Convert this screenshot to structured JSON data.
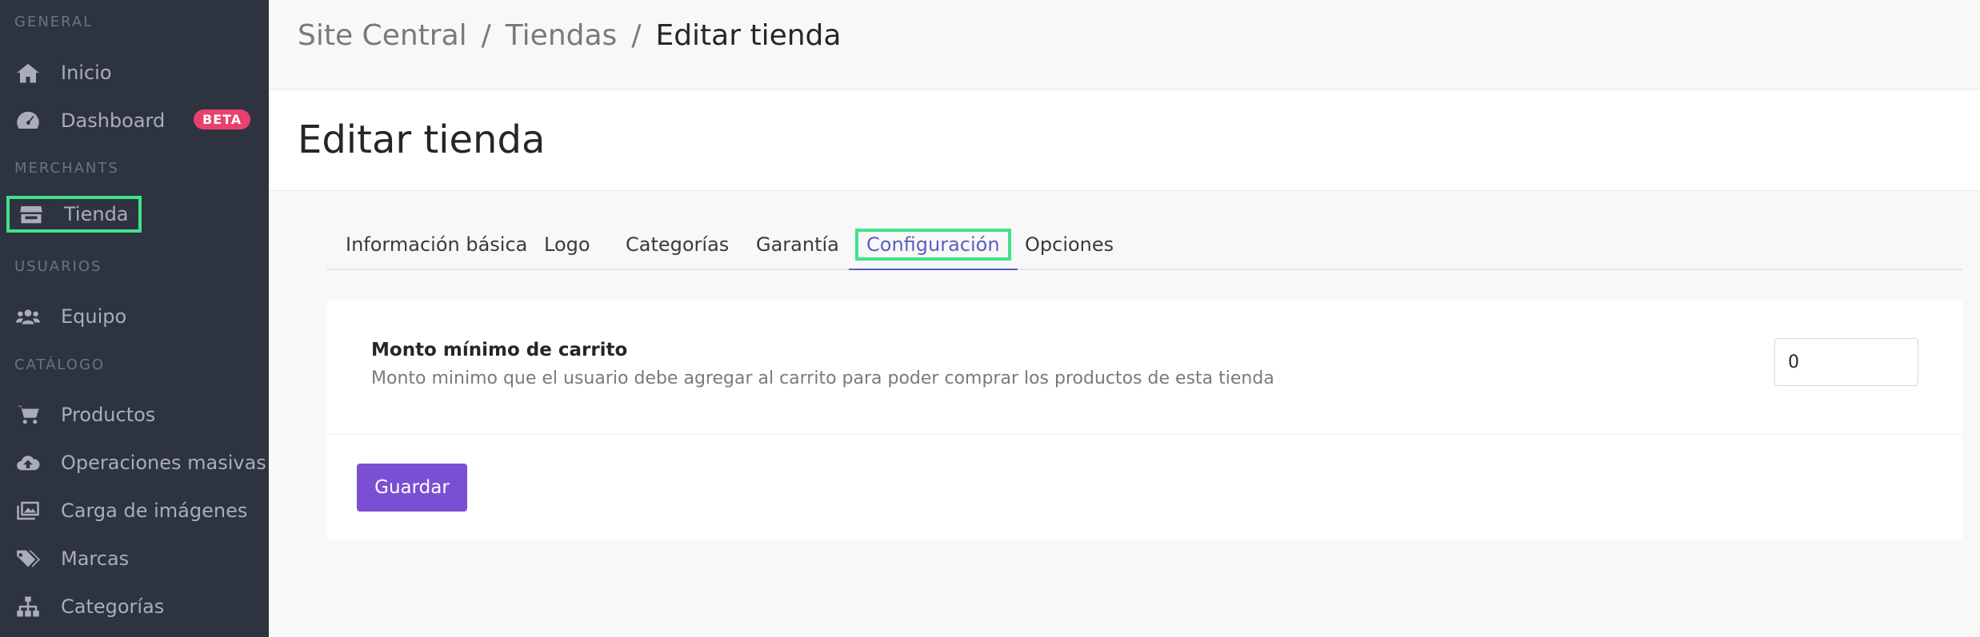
{
  "sidebar": {
    "sections": {
      "general": "GENERAL",
      "merchants": "MERCHANTS",
      "usuarios": "USUARIOS",
      "catalogo": "CATÁLOGO"
    },
    "items": [
      {
        "label": "Inicio",
        "icon": "home-icon"
      },
      {
        "label": "Dashboard",
        "icon": "dashboard-icon",
        "badge": "BETA"
      },
      {
        "label": "Tienda",
        "icon": "store-icon",
        "active": true
      },
      {
        "label": "Equipo",
        "icon": "team-icon"
      },
      {
        "label": "Productos",
        "icon": "cart-icon"
      },
      {
        "label": "Operaciones masivas",
        "icon": "cloud-upload-icon"
      },
      {
        "label": "Carga de imágenes",
        "icon": "images-icon"
      },
      {
        "label": "Marcas",
        "icon": "tags-icon"
      },
      {
        "label": "Categorías",
        "icon": "sitemap-icon"
      }
    ]
  },
  "breadcrumb": {
    "items": [
      "Site Central",
      "Tiendas",
      "Editar tienda"
    ],
    "separator": "/"
  },
  "page": {
    "title": "Editar tienda"
  },
  "tabs": [
    {
      "label": "Información básica"
    },
    {
      "label": "Logo"
    },
    {
      "label": "Categorías"
    },
    {
      "label": "Garantía"
    },
    {
      "label": "Configuración",
      "active": true
    },
    {
      "label": "Opciones"
    }
  ],
  "settings": {
    "min_cart": {
      "title": "Monto mínimo de carrito",
      "description": "Monto minimo que el usuario debe agregar al carrito para poder comprar los productos de esta tienda",
      "value": "0"
    },
    "save_label": "Guardar"
  },
  "colors": {
    "sidebar_bg": "#2e3340",
    "accent": "#7b4fd4",
    "tab_active": "#5a5fc0",
    "badge": "#e8416d",
    "highlight": "#3ee48a"
  }
}
